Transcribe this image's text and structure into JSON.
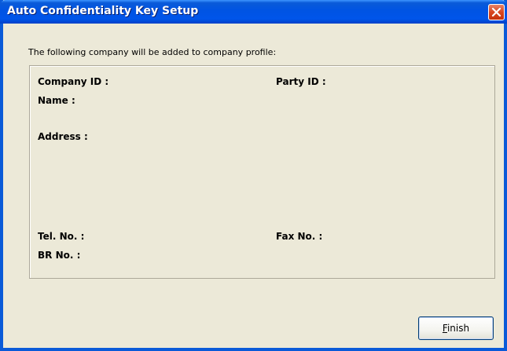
{
  "window": {
    "title": "Auto Confidentiality Key Setup"
  },
  "intro_text": "The following company will be added to company profile:",
  "fields": {
    "company_id_label": "Company ID :",
    "party_id_label": "Party ID :",
    "name_label": "Name :",
    "address_label": "Address :",
    "tel_label": "Tel. No. :",
    "fax_label": "Fax No. :",
    "br_label": "BR No. :"
  },
  "buttons": {
    "finish_mnemonic": "F",
    "finish_rest": "inish"
  },
  "icons": {
    "close": "close-icon"
  },
  "colors": {
    "titlebar": "#0054e3",
    "close_button": "#d8461f",
    "dialog_background": "#ece9d8"
  }
}
